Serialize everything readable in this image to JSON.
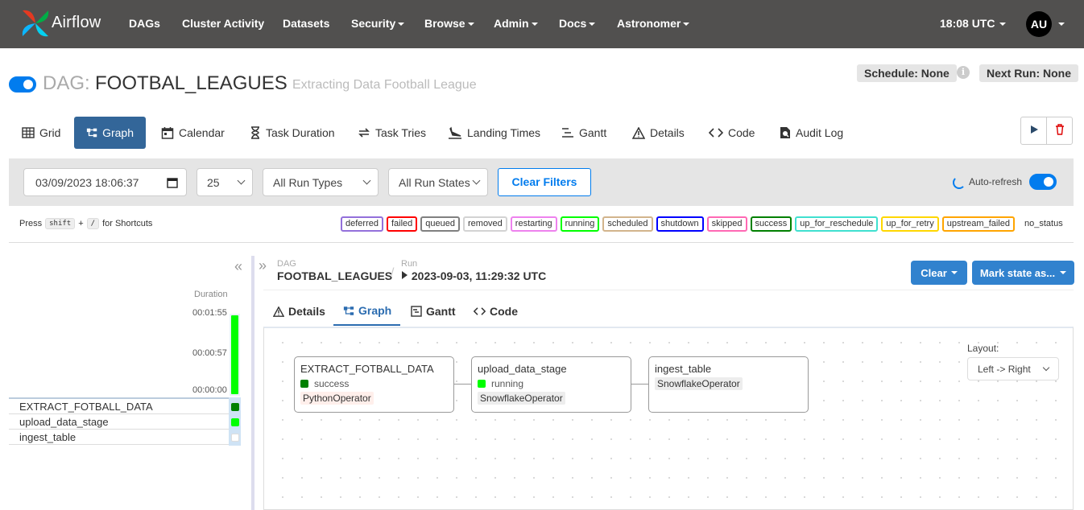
{
  "nav": {
    "brand": "Airflow",
    "items": [
      {
        "label": "DAGs"
      },
      {
        "label": "Cluster Activity"
      },
      {
        "label": "Datasets"
      },
      {
        "label": "Security"
      },
      {
        "label": "Browse"
      },
      {
        "label": "Admin"
      },
      {
        "label": "Docs"
      },
      {
        "label": "Astronomer"
      }
    ],
    "time": "18:08 UTC",
    "avatar": "AU"
  },
  "dag": {
    "prefix": "DAG:",
    "id": "FOOTBAL_LEAGUES",
    "description": "Extracting Data Football League",
    "schedule": "Schedule: None",
    "next_run": "Next Run: None",
    "info_icon": "i"
  },
  "views": [
    {
      "label": "Grid",
      "icon": "grid-icon"
    },
    {
      "label": "Graph",
      "icon": "graph-icon",
      "active": true
    },
    {
      "label": "Calendar",
      "icon": "calendar-icon"
    },
    {
      "label": "Task Duration",
      "icon": "hourglass-icon"
    },
    {
      "label": "Task Tries",
      "icon": "retry-icon"
    },
    {
      "label": "Landing Times",
      "icon": "landing-icon"
    },
    {
      "label": "Gantt",
      "icon": "gantt-icon"
    },
    {
      "label": "Details",
      "icon": "warning-icon"
    },
    {
      "label": "Code",
      "icon": "code-icon"
    },
    {
      "label": "Audit Log",
      "icon": "audit-log-icon"
    }
  ],
  "filters": {
    "datetime": "03/09/2023 18:06:37",
    "num_runs": "25",
    "run_type": "All Run Types",
    "run_state": "All Run States",
    "clear": "Clear Filters",
    "auto_refresh": "Auto-refresh"
  },
  "shortcuts": {
    "press": "Press",
    "key1": "shift",
    "plus": "+",
    "key2": "/",
    "suffix": "for Shortcuts"
  },
  "legend": [
    {
      "label": "deferred",
      "color": "#9370db"
    },
    {
      "label": "failed",
      "color": "#ff0000"
    },
    {
      "label": "queued",
      "color": "#808080"
    },
    {
      "label": "removed",
      "color": "#d3d3d3"
    },
    {
      "label": "restarting",
      "color": "#ee82ee"
    },
    {
      "label": "running",
      "color": "#00ff00"
    },
    {
      "label": "scheduled",
      "color": "#d2b48c"
    },
    {
      "label": "shutdown",
      "color": "#0000ff"
    },
    {
      "label": "skipped",
      "color": "#ff69b4"
    },
    {
      "label": "success",
      "color": "#008000"
    },
    {
      "label": "up_for_reschedule",
      "color": "#40e0d0"
    },
    {
      "label": "up_for_retry",
      "color": "#ffd700"
    },
    {
      "label": "upstream_failed",
      "color": "#ffa500"
    },
    {
      "label": "no_status",
      "color": "none"
    }
  ],
  "grid": {
    "duration_label": "Duration",
    "ticks": [
      "00:01:55",
      "00:00:57",
      "00:00:00"
    ],
    "tasks": [
      {
        "name": "EXTRACT_FOTBALL_DATA",
        "state_color": "#008000"
      },
      {
        "name": "upload_data_stage",
        "state_color": "#00ff00"
      },
      {
        "name": "ingest_table",
        "state_color": "#ffffff"
      }
    ]
  },
  "breadcrumb": {
    "dag_label": "DAG",
    "dag": "FOOTBAL_LEAGUES",
    "sep": "/",
    "run_label": "Run",
    "run": "2023-09-03, 11:29:32 UTC"
  },
  "actions": {
    "clear": "Clear",
    "mark_state": "Mark state as..."
  },
  "detail_tabs": [
    {
      "label": "Details",
      "icon": "warning-icon"
    },
    {
      "label": "Graph",
      "icon": "graph-icon",
      "active": true
    },
    {
      "label": "Gantt",
      "icon": "gantt-icon"
    },
    {
      "label": "Code",
      "icon": "code-icon"
    }
  ],
  "graph": {
    "nodes": [
      {
        "id": "EXTRACT_FOTBALL_DATA",
        "state": "success",
        "state_color": "#008000",
        "operator": "PythonOperator",
        "op_bg": "#ffefeb"
      },
      {
        "id": "upload_data_stage",
        "state": "running",
        "state_color": "#00ff00",
        "operator": "SnowflakeOperator",
        "op_bg": "#ededed"
      },
      {
        "id": "ingest_table",
        "state": "",
        "state_color": "none",
        "operator": "SnowflakeOperator",
        "op_bg": "#ededed"
      }
    ],
    "layout_label": "Layout:",
    "layout_value": "Left -> Right"
  }
}
